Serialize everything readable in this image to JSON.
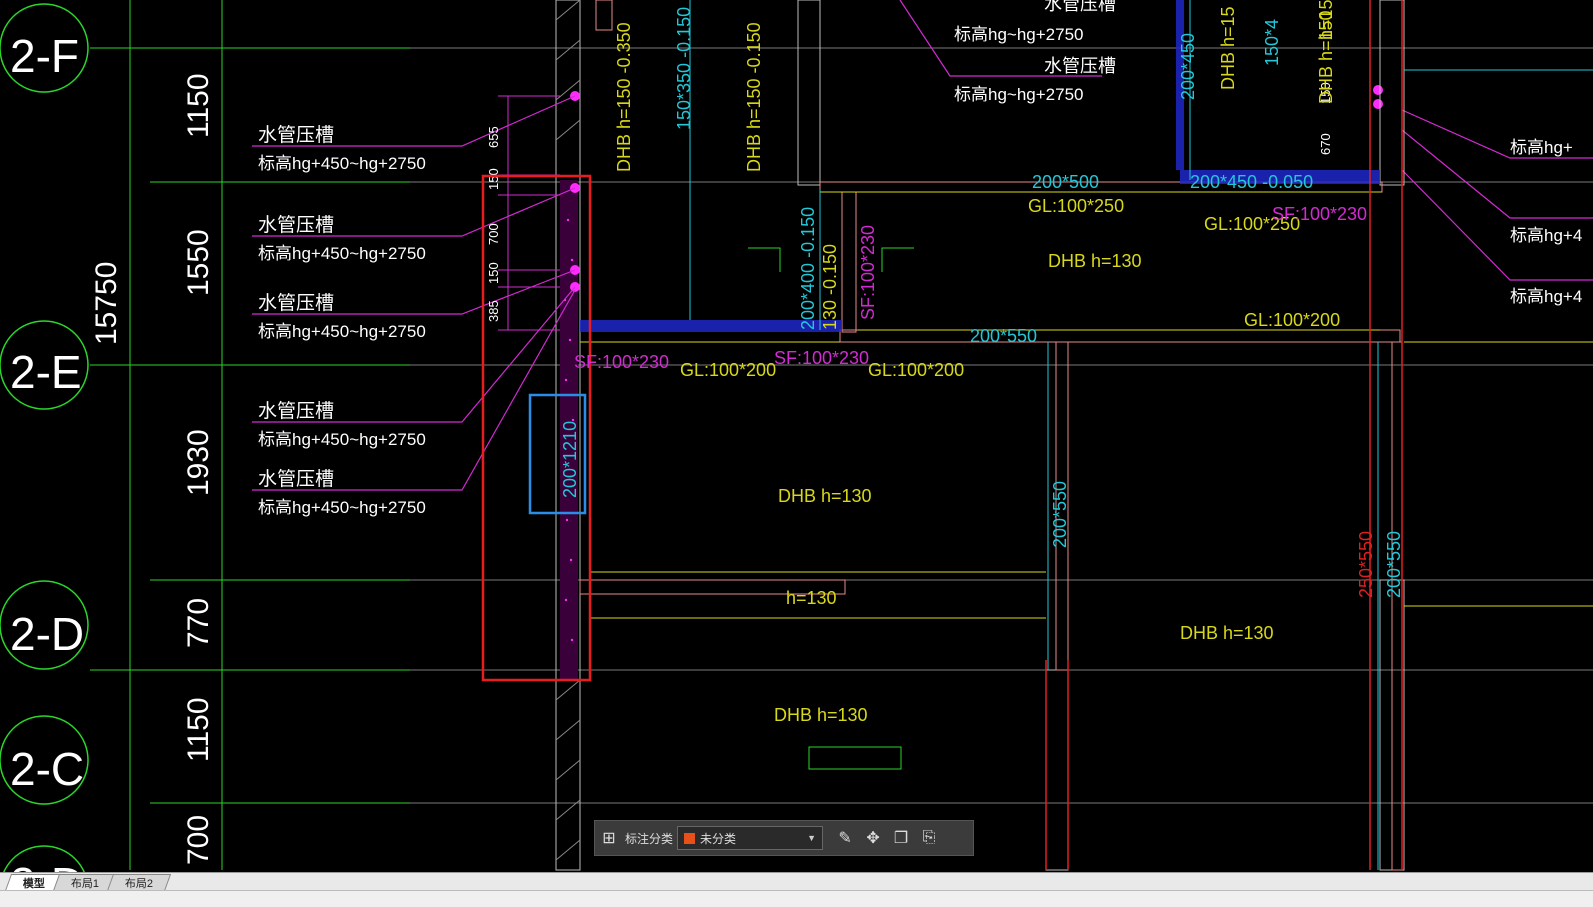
{
  "axis_labels": [
    "2-F",
    "2-E",
    "2-D",
    "2-C",
    "2-D"
  ],
  "dims_vertical": [
    "1150",
    "1550",
    "1930",
    "770",
    "1150",
    "700"
  ],
  "dim_total": "15750",
  "callouts": [
    {
      "title": "水管压槽",
      "sub": "标高hg+450~hg+2750"
    },
    {
      "title": "水管压槽",
      "sub": "标高hg+450~hg+2750"
    },
    {
      "title": "水管压槽",
      "sub": "标高hg+450~hg+2750"
    },
    {
      "title": "水管压槽",
      "sub": "标高hg+450~hg+2750"
    },
    {
      "title": "水管压槽",
      "sub": "标高hg+450~hg+2750"
    }
  ],
  "callouts_top": [
    {
      "title": "水管压槽",
      "sub": "标高hg~hg+2750"
    },
    {
      "title": "水管压槽",
      "sub": "标高hg~hg+2750"
    }
  ],
  "right_edge_labels": [
    "标高hg+",
    "标高hg+4",
    "标高hg+4"
  ],
  "small_dims": [
    "655",
    "150",
    "700",
    "150",
    "385",
    "670",
    "150"
  ],
  "beam_labels": {
    "dhb150_a": "DHB h=150  -0.350",
    "dhb150_b": "DHB h=150  -0.150",
    "v150_350": "150*350  -0.150",
    "v200_450": "200*450",
    "dhb_h15": "DHB h=15",
    "v150_4": "150*4",
    "v200_500": "200*500",
    "v200_450_h": "200*450  -0.050",
    "gl100_250_a": "GL:100*250",
    "gl100_250_b": "GL:100*250",
    "sf100_230_a": "SF:100*230",
    "dhb130_a": "DHB h=130",
    "v200_400": "200*400  -0.150",
    "v130_150": "130  -0.150",
    "sf100_230_v": "SF:100*230",
    "gl100_200_a": "GL:100*200",
    "v200_550_h": "200*550",
    "sf100_230_b": "SF:100*230",
    "gl100_200_b": "GL:100*200",
    "sf100_230_c": "SF:100*230",
    "gl100_200_c": "GL:100*200",
    "v200_1210": "200*1210",
    "dhb130_b": "DHB h=130",
    "v200_550_v": "200*550",
    "v250_550": "250*550",
    "v200_550_v2": "200*550",
    "h130": "h=130",
    "dhb130_c": "DHB h=130",
    "dhb130_d": "DHB h=130",
    "dhb_h150_r": "DHB h=150",
    "h150": "h=150"
  },
  "toolbar": {
    "label": "标注分类",
    "selected": "未分类",
    "swatch_color": "#e8501a"
  },
  "tabs": [
    "模型",
    "布局1",
    "布局2"
  ]
}
